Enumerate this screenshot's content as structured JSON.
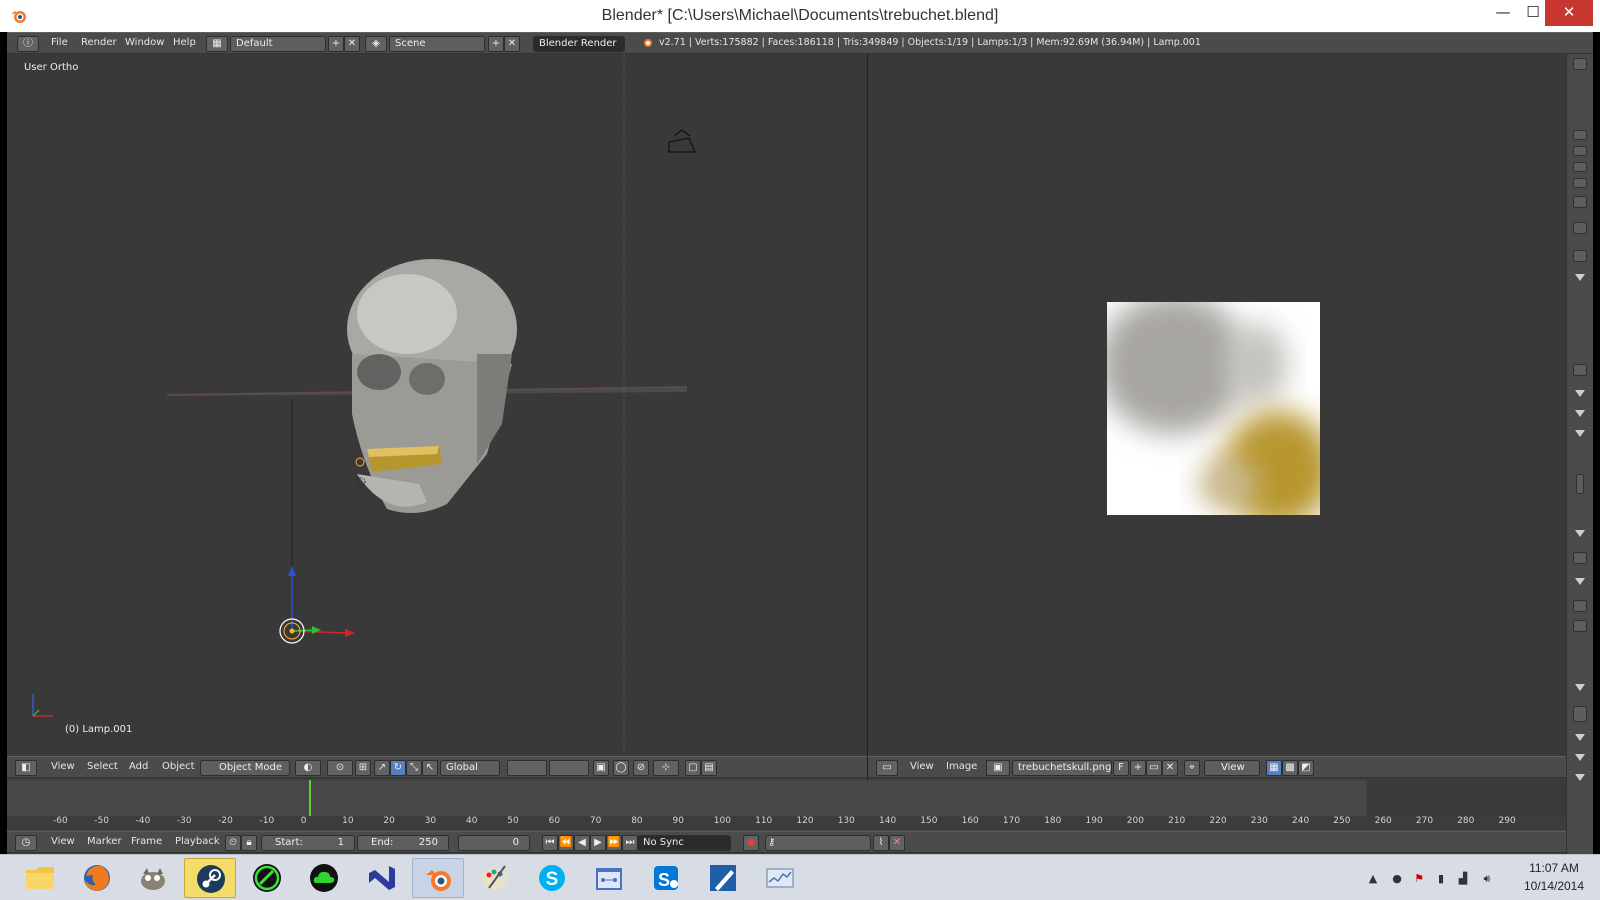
{
  "window": {
    "title": "Blender* [C:\\Users\\Michael\\Documents\\trebuchet.blend]",
    "minimize": "—",
    "maximize": "☐",
    "close": "✕"
  },
  "info_header": {
    "menus": [
      "File",
      "Render",
      "Window",
      "Help"
    ],
    "layout": "Default",
    "scene": "Scene",
    "engine": "Blender Render",
    "stats": "v2.71 | Verts:175882 | Faces:186118 | Tris:349849 | Objects:1/19 | Lamps:1/3 | Mem:92.69M (36.94M) | Lamp.001"
  },
  "viewport3d": {
    "view_label": "User Ortho",
    "object_label": "(0) Lamp.001",
    "menus": [
      "View",
      "Select",
      "Add",
      "Object"
    ],
    "mode": "Object Mode",
    "orientation": "Global"
  },
  "image_editor": {
    "menus": [
      "View",
      "Image"
    ],
    "image_name": "trebuchetskull.png",
    "fake_user": "F",
    "view_label": "View"
  },
  "timeline": {
    "menus": [
      "View",
      "Marker",
      "Frame",
      "Playback"
    ],
    "start_label": "Start:",
    "start": "1",
    "end_label": "End:",
    "end": "250",
    "current": "0",
    "sync": "No Sync",
    "ruler": [
      "-60",
      "-50",
      "-40",
      "-30",
      "-20",
      "-10",
      "0",
      "10",
      "20",
      "30",
      "40",
      "50",
      "60",
      "70",
      "80",
      "90",
      "100",
      "110",
      "120",
      "130",
      "140",
      "150",
      "160",
      "170",
      "180",
      "190",
      "200",
      "210",
      "220",
      "230",
      "240",
      "250",
      "260",
      "270",
      "280",
      "290"
    ]
  },
  "taskbar": {
    "apps": [
      "file-explorer",
      "firefox",
      "gimp",
      "steam",
      "razer",
      "cloud",
      "visual-studio",
      "blender",
      "paint",
      "skype",
      "network",
      "skype-business",
      "sketch",
      "performance"
    ],
    "time": "11:07 AM",
    "date": "10/14/2014"
  },
  "colors": {
    "blender_bg": "#393939",
    "header": "#4b4b4b",
    "accent": "#5680c2",
    "frame_marker": "#60d040",
    "skull_gold": "#b8962e"
  }
}
